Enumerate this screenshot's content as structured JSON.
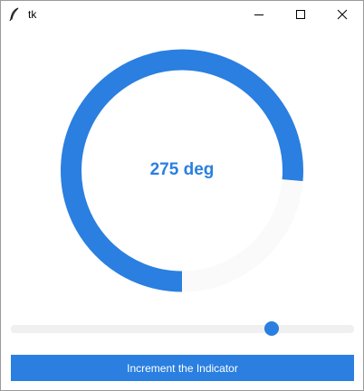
{
  "window": {
    "title": "tk",
    "icon": "feather-icon"
  },
  "titlebar_buttons": [
    "minimize-icon",
    "maximize-icon",
    "close-icon"
  ],
  "meter": {
    "value_text": "275 deg",
    "angle_deg": 275,
    "max_deg": 360,
    "accent_color": "#2a7fe0",
    "trough_color": "#fafafa"
  },
  "slider": {
    "value_fraction": 0.76,
    "thumb_color": "#2a7fe0",
    "track_color": "#f0f0f0"
  },
  "button": {
    "label": "Increment the Indicator",
    "color": "#2a7fe0"
  }
}
